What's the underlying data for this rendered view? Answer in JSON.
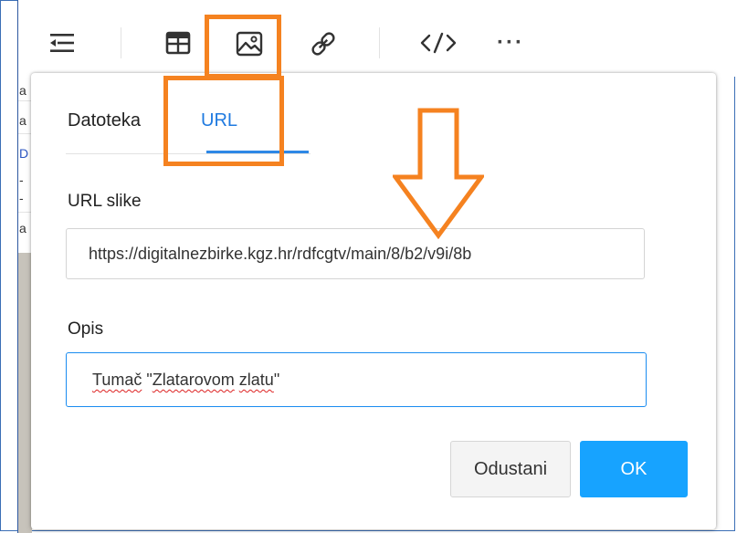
{
  "toolbar": {
    "items": [
      "outdent-icon",
      "table-icon",
      "image-icon",
      "link-icon",
      "code-icon",
      "more-icon"
    ],
    "more_label": "···"
  },
  "editor_fragments": [
    "a",
    "a",
    "D",
    "-",
    "-",
    "a"
  ],
  "dialog": {
    "tabs": [
      {
        "label": "Datoteka",
        "active": false
      },
      {
        "label": "URL",
        "active": true
      }
    ],
    "url_field": {
      "label": "URL slike",
      "value": "https://digitalnezbirke.kgz.hr/rdfcgtv/main/8/b2/v9i/8b"
    },
    "description_field": {
      "label": "Opis",
      "value_parts": [
        "Tumač",
        " \"",
        "Zlatarovom",
        " ",
        "zlatu",
        "\""
      ]
    },
    "buttons": {
      "cancel": "Odustani",
      "ok": "OK"
    }
  },
  "colors": {
    "accent": "#17a3ff",
    "tab_active": "#1f7ae0",
    "annotation": "#f58220",
    "frame": "#3b6fb6"
  }
}
